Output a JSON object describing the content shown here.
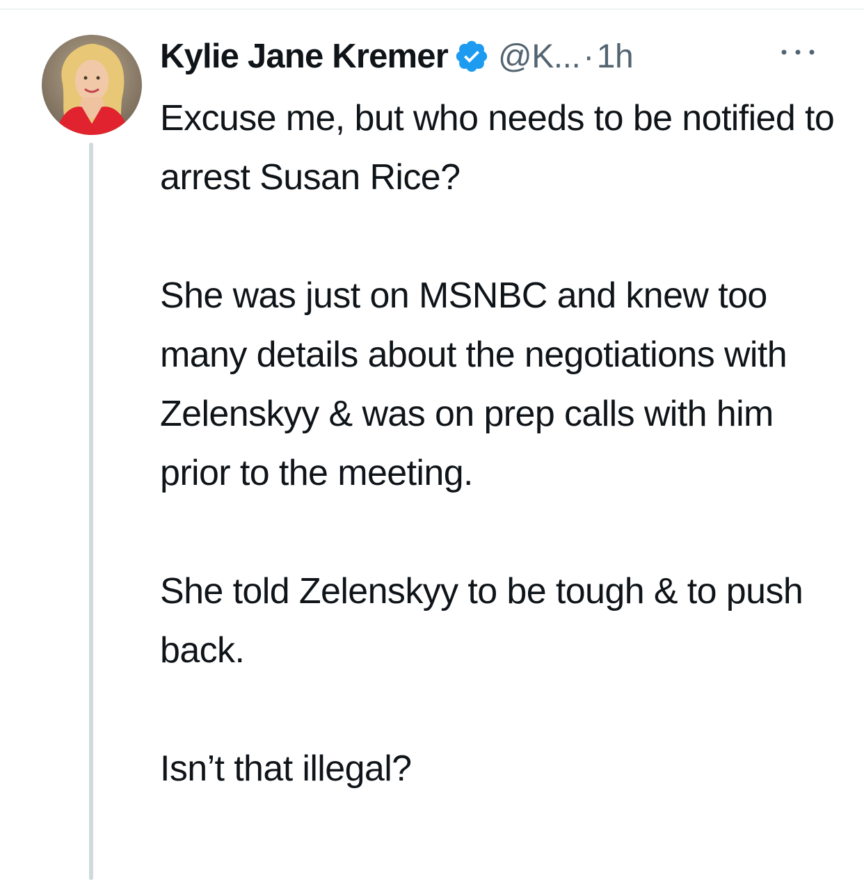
{
  "author": {
    "name": "Kylie Jane Kremer",
    "handle": "@K...",
    "separator": "·",
    "time": "1h",
    "verified": true,
    "verified_color": "#1d9bf0"
  },
  "avatar": {
    "icon": "profile-photo"
  },
  "more": {
    "icon": "more-horizontal-icon"
  },
  "tweet": {
    "paragraphs": [
      "Excuse me, but who needs to be notified to arrest Susan Rice?",
      "She was just on MSNBC and knew too many details about the negotiations with Zelenskyy & was on prep calls with him prior to the meeting.",
      "She told Zelenskyy to be tough & to push back.",
      "Isn’t that illegal?"
    ]
  },
  "colors": {
    "text_primary": "#0f1419",
    "text_secondary": "#536471",
    "thread_line": "#cfd9de",
    "divider": "#eff3f4"
  }
}
